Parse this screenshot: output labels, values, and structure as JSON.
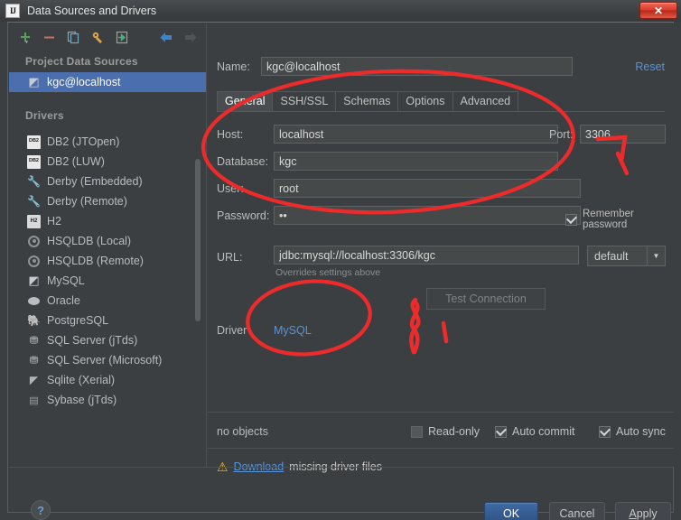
{
  "window": {
    "title": "Data Sources and Drivers",
    "app_icon": "IJ",
    "close_label": "✕"
  },
  "toolbar": {
    "items": [
      {
        "name": "add-icon",
        "label": "+"
      },
      {
        "name": "remove-icon",
        "label": "−"
      },
      {
        "name": "copy-icon",
        "label": "copy"
      },
      {
        "name": "driver-icon",
        "label": "driver"
      },
      {
        "name": "import-icon",
        "label": "import"
      },
      {
        "name": "back-arrow-icon",
        "label": "back"
      },
      {
        "name": "forward-arrow-icon",
        "label": "forward"
      }
    ]
  },
  "sidebar": {
    "project_group": "Project Data Sources",
    "data_sources": [
      {
        "label": "kgc@localhost",
        "icon": "mysql-icon",
        "selected": true
      }
    ],
    "drivers_group": "Drivers",
    "drivers": [
      {
        "label": "DB2 (JTOpen)",
        "icon": "db2-icon"
      },
      {
        "label": "DB2 (LUW)",
        "icon": "db2-icon"
      },
      {
        "label": "Derby (Embedded)",
        "icon": "wrench-icon"
      },
      {
        "label": "Derby (Remote)",
        "icon": "wrench-icon"
      },
      {
        "label": "H2",
        "icon": "h2-icon"
      },
      {
        "label": "HSQLDB (Local)",
        "icon": "ring-icon"
      },
      {
        "label": "HSQLDB (Remote)",
        "icon": "ring-icon"
      },
      {
        "label": "MySQL",
        "icon": "mysql-icon"
      },
      {
        "label": "Oracle",
        "icon": "oracle-icon"
      },
      {
        "label": "PostgreSQL",
        "icon": "postgres-icon"
      },
      {
        "label": "SQL Server (jTds)",
        "icon": "sqlserver-icon"
      },
      {
        "label": "SQL Server (Microsoft)",
        "icon": "sqlserver-icon"
      },
      {
        "label": "Sqlite (Xerial)",
        "icon": "sqlite-icon"
      },
      {
        "label": "Sybase (jTds)",
        "icon": "sybase-icon"
      }
    ]
  },
  "panel": {
    "name_label": "Name:",
    "name_value": "kgc@localhost",
    "reset_label": "Reset",
    "tabs": [
      {
        "label": "General",
        "active": true
      },
      {
        "label": "SSH/SSL",
        "active": false
      },
      {
        "label": "Schemas",
        "active": false
      },
      {
        "label": "Options",
        "active": false
      },
      {
        "label": "Advanced",
        "active": false
      }
    ],
    "host_label": "Host:",
    "host_value": "localhost",
    "port_label": "Port:",
    "port_value": "3306",
    "database_label": "Database:",
    "database_value": "kgc",
    "user_label": "User:",
    "user_value": "root",
    "password_label": "Password:",
    "password_value": "••",
    "remember_password_label": "Remember password",
    "remember_password_checked": true,
    "url_label": "URL:",
    "url_value": "jdbc:mysql://localhost:3306/kgc",
    "url_hint": "Overrides settings above",
    "url_combo_value": "default",
    "url_combo_arrow": "▼",
    "test_connection_label": "Test Connection",
    "driver_label": "Driver",
    "driver_value": "MySQL",
    "objects_text": "no objects",
    "readonly_label": "Read-only",
    "readonly_checked": false,
    "autocommit_label": "Auto commit",
    "autocommit_checked": true,
    "autosync_label": "Auto sync",
    "autosync_checked": true,
    "download_warning_icon": "⚠",
    "download_link": "Download",
    "download_suffix": "missing driver files"
  },
  "buttons": {
    "help_label": "?",
    "ok_label": "OK",
    "cancel_label": "Cancel",
    "apply_label": "Apply"
  },
  "annotations": {
    "color": "#ee2b2b",
    "marks": [
      {
        "name": "ellipse-connection-fields",
        "type": "ellipse"
      },
      {
        "name": "ellipse-driver-field",
        "type": "ellipse"
      },
      {
        "name": "scribble-arrow-right",
        "type": "scribble"
      },
      {
        "name": "scribble-figure-eight",
        "type": "scribble"
      }
    ]
  },
  "colors": {
    "bg": "#3c3f41",
    "field_bg": "#45494a",
    "accent_blue": "#5894d6",
    "selection_blue": "#4b6eaf",
    "annotation_red": "#ee2b2b",
    "warning_yellow": "#e8b931"
  }
}
